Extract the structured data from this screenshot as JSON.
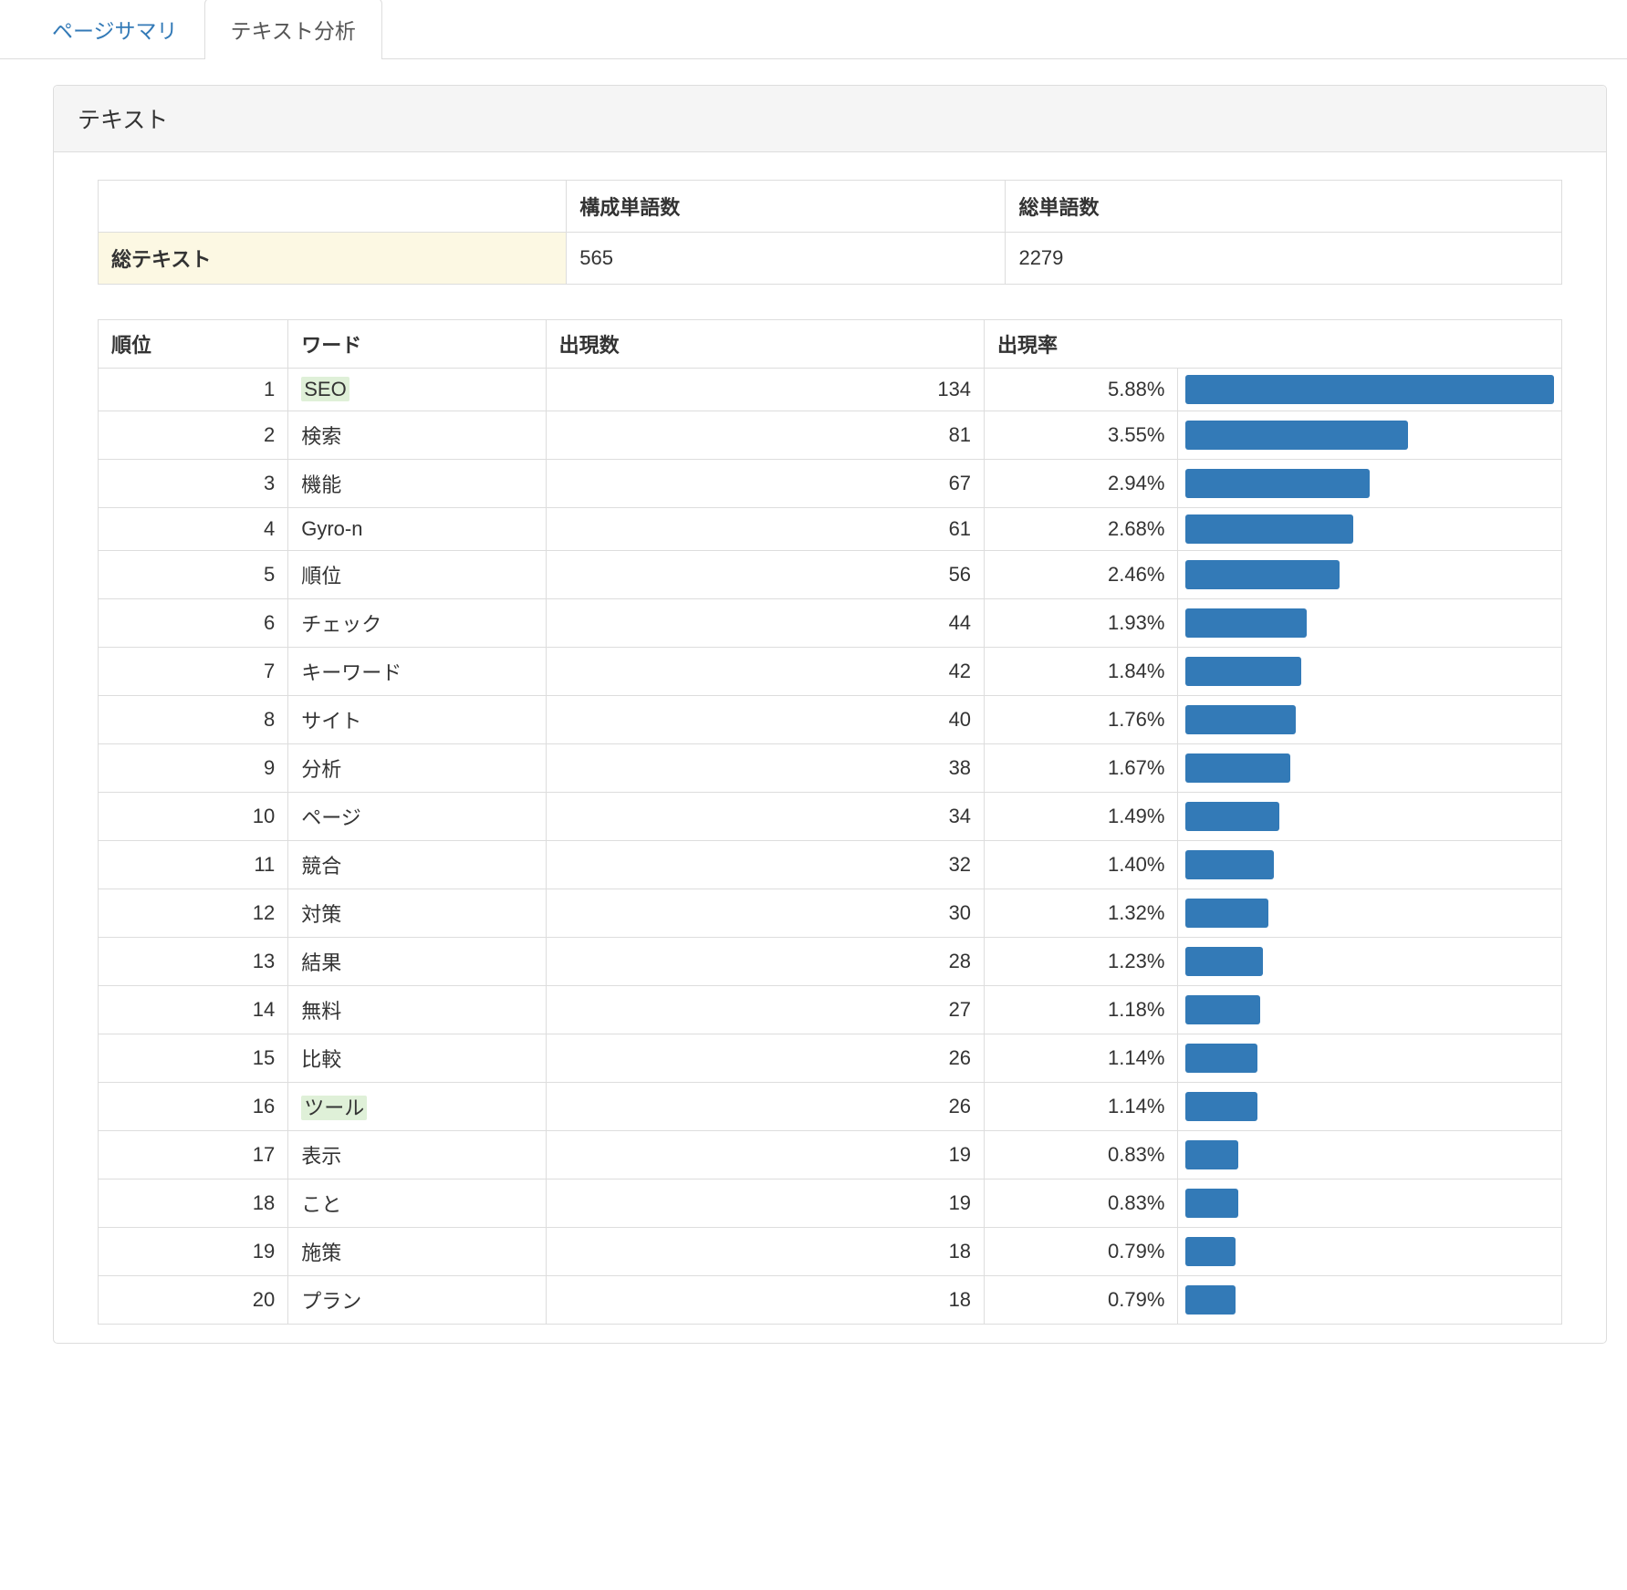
{
  "tabs": {
    "page_summary": "ページサマリ",
    "text_analysis": "テキスト分析"
  },
  "panel": {
    "title": "テキスト"
  },
  "summary_table": {
    "headers": {
      "blank": "",
      "unique_words": "構成単語数",
      "total_words": "総単語数"
    },
    "row_label": "総テキスト",
    "unique_words": "565",
    "total_words": "2279"
  },
  "words_table": {
    "headers": {
      "rank": "順位",
      "word": "ワード",
      "count": "出現数",
      "rate": "出現率"
    },
    "max_count": 134,
    "rows": [
      {
        "rank": "1",
        "word": "SEO",
        "count": 134,
        "rate": "5.88%",
        "highlight": true
      },
      {
        "rank": "2",
        "word": "検索",
        "count": 81,
        "rate": "3.55%",
        "highlight": false
      },
      {
        "rank": "3",
        "word": "機能",
        "count": 67,
        "rate": "2.94%",
        "highlight": false
      },
      {
        "rank": "4",
        "word": "Gyro-n",
        "count": 61,
        "rate": "2.68%",
        "highlight": false
      },
      {
        "rank": "5",
        "word": "順位",
        "count": 56,
        "rate": "2.46%",
        "highlight": false
      },
      {
        "rank": "6",
        "word": "チェック",
        "count": 44,
        "rate": "1.93%",
        "highlight": false
      },
      {
        "rank": "7",
        "word": "キーワード",
        "count": 42,
        "rate": "1.84%",
        "highlight": false
      },
      {
        "rank": "8",
        "word": "サイト",
        "count": 40,
        "rate": "1.76%",
        "highlight": false
      },
      {
        "rank": "9",
        "word": "分析",
        "count": 38,
        "rate": "1.67%",
        "highlight": false
      },
      {
        "rank": "10",
        "word": "ページ",
        "count": 34,
        "rate": "1.49%",
        "highlight": false
      },
      {
        "rank": "11",
        "word": "競合",
        "count": 32,
        "rate": "1.40%",
        "highlight": false
      },
      {
        "rank": "12",
        "word": "対策",
        "count": 30,
        "rate": "1.32%",
        "highlight": false
      },
      {
        "rank": "13",
        "word": "結果",
        "count": 28,
        "rate": "1.23%",
        "highlight": false
      },
      {
        "rank": "14",
        "word": "無料",
        "count": 27,
        "rate": "1.18%",
        "highlight": false
      },
      {
        "rank": "15",
        "word": "比較",
        "count": 26,
        "rate": "1.14%",
        "highlight": false
      },
      {
        "rank": "16",
        "word": "ツール",
        "count": 26,
        "rate": "1.14%",
        "highlight": true
      },
      {
        "rank": "17",
        "word": "表示",
        "count": 19,
        "rate": "0.83%",
        "highlight": false
      },
      {
        "rank": "18",
        "word": "こと",
        "count": 19,
        "rate": "0.83%",
        "highlight": false
      },
      {
        "rank": "19",
        "word": "施策",
        "count": 18,
        "rate": "0.79%",
        "highlight": false
      },
      {
        "rank": "20",
        "word": "プラン",
        "count": 18,
        "rate": "0.79%",
        "highlight": false
      }
    ]
  },
  "colors": {
    "bar": "#337ab7",
    "highlight_bg": "#dff0d8",
    "tab_link": "#337ab7"
  }
}
